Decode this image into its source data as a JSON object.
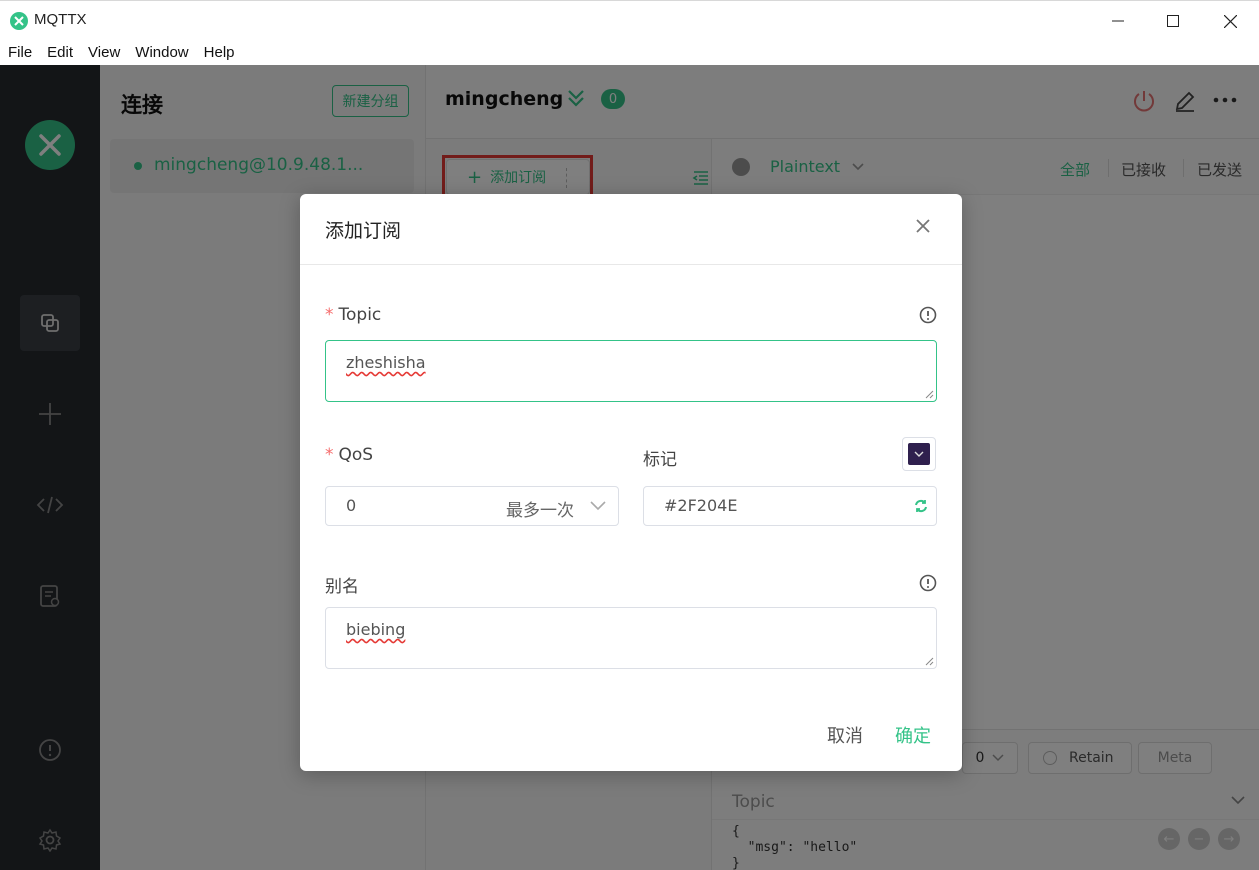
{
  "window": {
    "title": "MQTTX"
  },
  "menu": [
    "File",
    "Edit",
    "View",
    "Window",
    "Help"
  ],
  "connections": {
    "heading": "连接",
    "new_group_label": "新建分组",
    "items": [
      {
        "name": "mingcheng@10.9.48.1...",
        "status_color": "#34c388"
      }
    ]
  },
  "client": {
    "name": "mingcheng",
    "subscription_count": "0"
  },
  "subscriptions": {
    "add_label": "添加订阅"
  },
  "messages": {
    "payload_type": "Plaintext",
    "filters": [
      "全部",
      "已接收",
      "已发送"
    ],
    "active_filter": "全部"
  },
  "publish": {
    "qos": "0",
    "retain_label": "Retain",
    "meta_label": "Meta",
    "topic_placeholder": "Topic",
    "payload_lines": [
      "{",
      "  \"msg\": \"hello\"",
      "}"
    ]
  },
  "dialog": {
    "title": "添加订阅",
    "topic_label": "Topic",
    "topic_value": "zheshisha",
    "qos_label": "QoS",
    "qos_value": "0",
    "qos_desc": "最多一次",
    "mark_label": "标记",
    "mark_color": "#2F204E",
    "alias_label": "别名",
    "alias_value": "biebing",
    "cancel_label": "取消",
    "confirm_label": "确定"
  },
  "colors": {
    "accent": "#34c388",
    "sidebar": "#262a2f",
    "highlight": "#e53935"
  }
}
